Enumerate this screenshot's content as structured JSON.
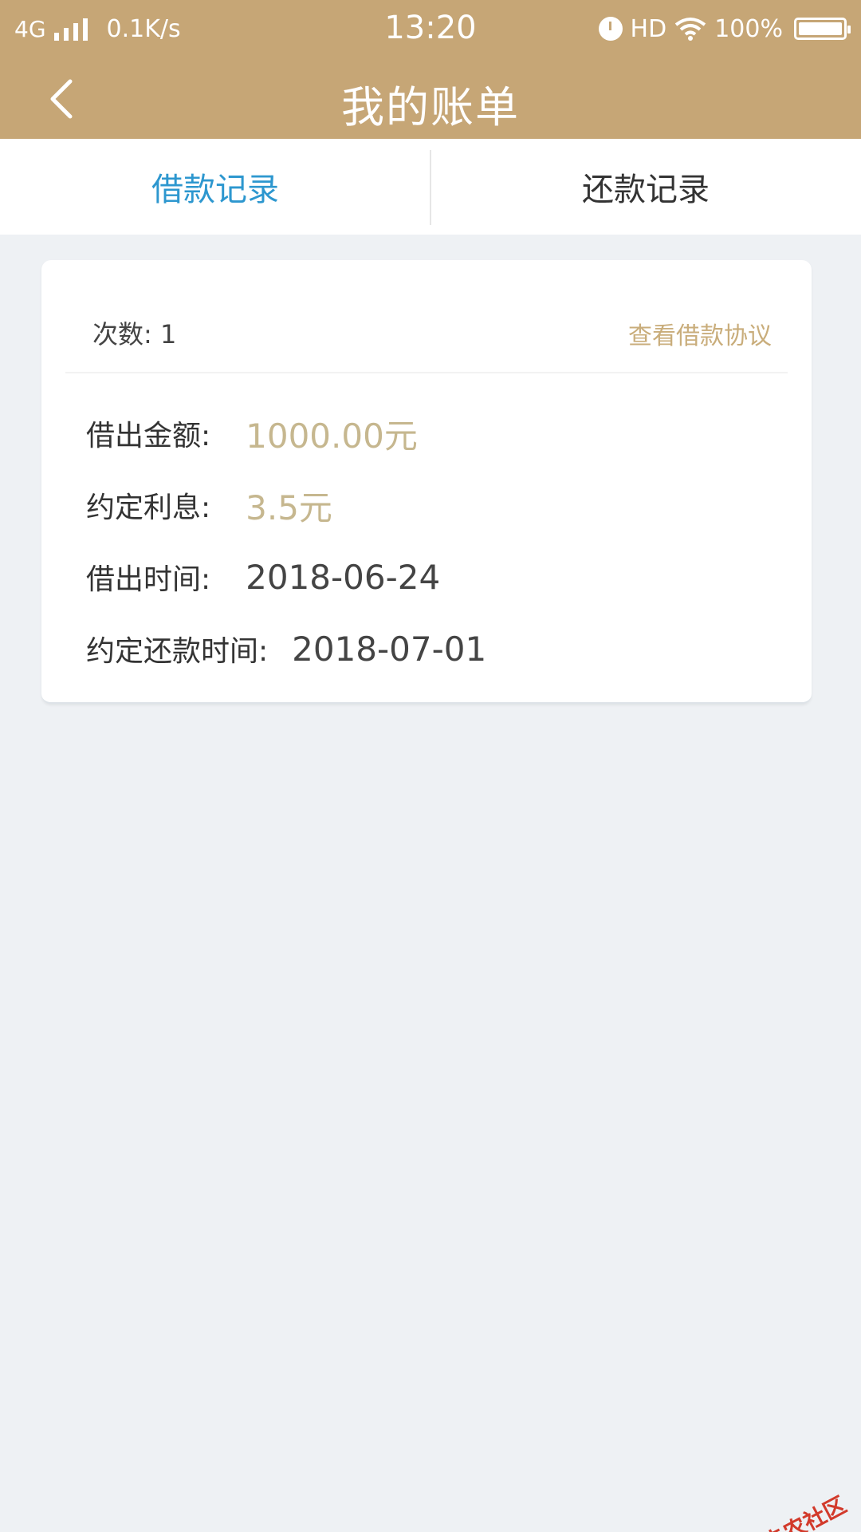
{
  "status_bar": {
    "network": "4G",
    "speed": "0.1K/s",
    "time": "13:20",
    "hd": "HD",
    "battery": "100%"
  },
  "header": {
    "title": "我的账单",
    "back_icon": "chevron-left-icon"
  },
  "tabs": [
    {
      "label": "借款记录",
      "active": true
    },
    {
      "label": "还款记录",
      "active": false
    }
  ],
  "record": {
    "count_label": "次数",
    "count_value": "1",
    "agreement_link": "查看借款协议",
    "rows": [
      {
        "label": "借出金额:",
        "value": "1000.00元"
      },
      {
        "label": "约定利息:",
        "value": "3.5元"
      },
      {
        "label": "借出时间:",
        "value": "2018-06-24"
      },
      {
        "label": "约定还款时间:",
        "value": "2018-07-01"
      }
    ]
  },
  "watermark": "卡农社区",
  "colors": {
    "header_bg": "#c6a676",
    "active_tab": "#2d97cf",
    "gold_value": "#c6b78f",
    "link": "#c9ad7b",
    "page_bg": "#eef1f4"
  }
}
